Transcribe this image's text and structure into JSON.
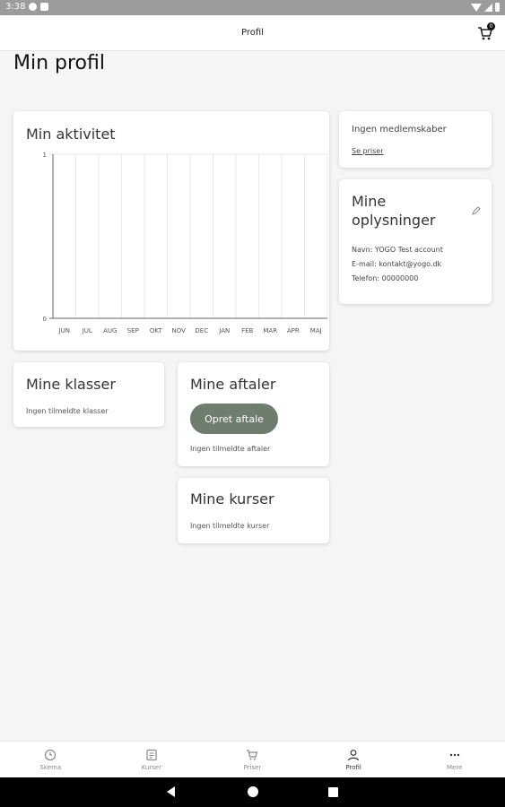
{
  "status_bar": {
    "time": "3:38",
    "icons": [
      "google-icon",
      "sim-icon",
      "wifi-icon",
      "signal-icon",
      "battery-icon"
    ]
  },
  "top_bar": {
    "title": "Profil",
    "cart_icon": "cart-icon",
    "cart_count": "0"
  },
  "page": {
    "title": "Min profil"
  },
  "activity": {
    "heading": "Min aktivitet"
  },
  "chart_data": {
    "type": "bar",
    "categories": [
      "JUN",
      "JUL",
      "AUG",
      "SEP",
      "OKT",
      "NOV",
      "DEC",
      "JAN",
      "FEB",
      "MAR",
      "APR",
      "MAJ"
    ],
    "values": [
      0,
      0,
      0,
      0,
      0,
      0,
      0,
      0,
      0,
      0,
      0,
      0
    ],
    "ylim": [
      0,
      1
    ],
    "yticks": [
      "0",
      "1"
    ],
    "grid": true
  },
  "membership": {
    "text": "Ingen medlemskaber",
    "link": "Se priser"
  },
  "info": {
    "heading": "Mine oplysninger",
    "edit_icon": "pencil-icon",
    "name": "Navn: YOGO Test account",
    "email": "E-mail: kontakt@yogo.dk",
    "phone": "Telefon: 00000000"
  },
  "classes": {
    "heading": "Mine klasser",
    "empty": "Ingen tilmeldte klasser"
  },
  "appointments": {
    "heading": "Mine aftaler",
    "button": "Opret aftale",
    "empty": "Ingen tilmeldte aftaler"
  },
  "courses": {
    "heading": "Mine kurser",
    "empty": "Ingen tilmeldte kurser"
  },
  "bottom_nav": {
    "items": [
      {
        "label": "Skema",
        "icon": "clock-icon"
      },
      {
        "label": "Kurser",
        "icon": "list-icon"
      },
      {
        "label": "Priser",
        "icon": "cart-icon"
      },
      {
        "label": "Profil",
        "icon": "person-icon"
      },
      {
        "label": "Mere",
        "icon": "more-icon"
      }
    ],
    "active_index": 3
  },
  "colors": {
    "accent_button": "#6f7d6f",
    "background": "#f5f5f5",
    "card": "#ffffff"
  }
}
